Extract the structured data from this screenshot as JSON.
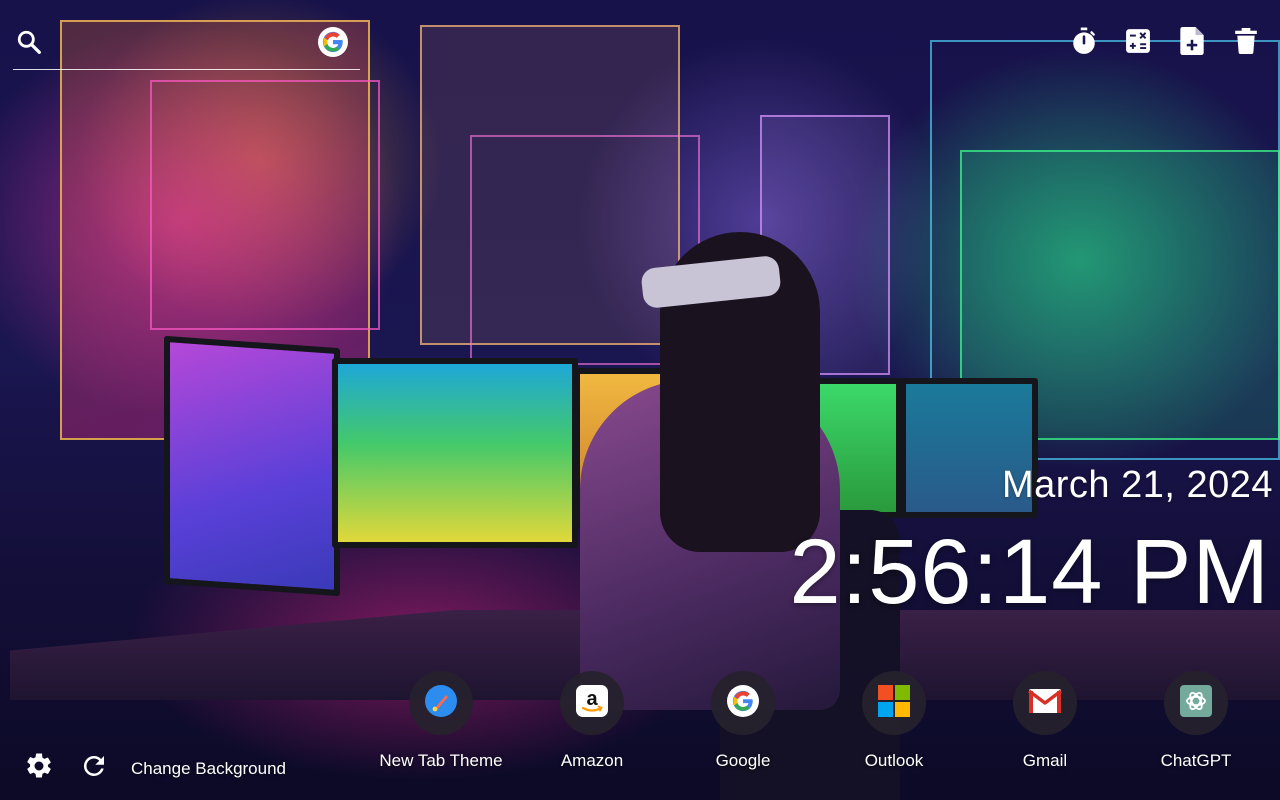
{
  "search": {
    "value": "",
    "placeholder": "",
    "engine_icon": "google-g-icon"
  },
  "toolbar": {
    "icons": [
      "stopwatch-icon",
      "calculator-icon",
      "note-add-icon",
      "trash-icon"
    ]
  },
  "clock": {
    "date": "March 21, 2024",
    "time": "2:56:14 PM"
  },
  "shortcuts": [
    {
      "label": "New Tab Theme",
      "icon": "new-tab-theme-icon"
    },
    {
      "label": "Amazon",
      "icon": "amazon-icon"
    },
    {
      "label": "Google",
      "icon": "google-icon"
    },
    {
      "label": "Outlook",
      "icon": "outlook-icon"
    },
    {
      "label": "Gmail",
      "icon": "gmail-icon"
    },
    {
      "label": "ChatGPT",
      "icon": "chatgpt-icon"
    }
  ],
  "footer": {
    "change_background_label": "Change Background"
  },
  "colors": {
    "text": "#ffffff",
    "shortcut_bg": "#26222c"
  }
}
